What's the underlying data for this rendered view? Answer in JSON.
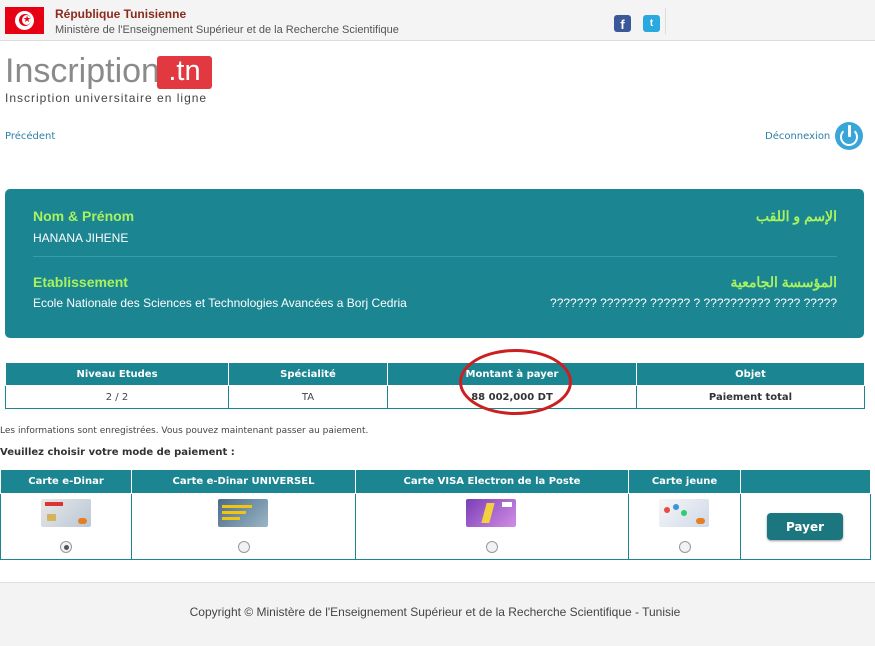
{
  "header": {
    "republic": "République Tunisienne",
    "ministry": "Ministère de l'Enseignement Supérieur et de la Recherche Scientifique",
    "facebook_icon": "f",
    "twitter_icon": "t"
  },
  "logo": {
    "word": "Inscription",
    "tld": ".tn",
    "tagline": "Inscription universitaire en ligne"
  },
  "nav": {
    "previous": "Précédent",
    "logout": "Déconnexion"
  },
  "student": {
    "name_label_fr": "Nom & Prénom",
    "name_label_ar": "الإسم و اللقب",
    "name_value": "HANANA JIHENE",
    "institution_label_fr": "Etablissement",
    "institution_label_ar": "المؤسسة الجامعية",
    "institution_value_fr": "Ecole Nationale des Sciences et Technologies Avancées a Borj Cedria",
    "institution_value_ar": "??????? ??????? ?????? ? ?????????? ???? ?????"
  },
  "summary": {
    "headers": [
      "Niveau Etudes",
      "Spécialité",
      "Montant à payer",
      "Objet"
    ],
    "row": [
      "2 / 2",
      "TA",
      "88 002,000 DT",
      "Paiement total"
    ]
  },
  "messages": {
    "saved": "Les informations sont enregistrées. Vous pouvez maintenant passer au paiement.",
    "choose": "Veuillez choisir votre mode de paiement :"
  },
  "payment": {
    "options": [
      "Carte e-Dinar",
      "Carte e-Dinar UNIVERSEL",
      "Carte VISA Electron de la Poste",
      "Carte jeune"
    ],
    "selected_index": 0,
    "pay_button": "Payer"
  },
  "footer": {
    "copyright": "Copyright © Ministère de l'Enseignement Supérieur et de la Recherche Scientifique - Tunisie"
  },
  "colors": {
    "teal": "#1b8591",
    "accent_green": "#a8f25f",
    "link_blue": "#2e7fa8",
    "logo_red": "#e2383f",
    "annotation_red": "#cc2020"
  }
}
